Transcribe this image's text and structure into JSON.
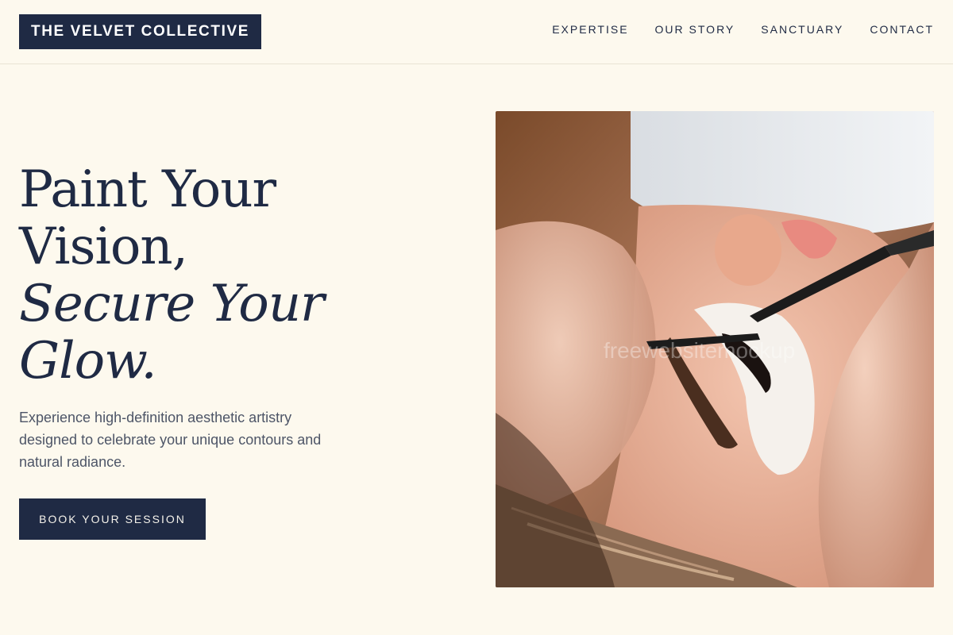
{
  "header": {
    "logo": "THE VELVET COLLECTIVE",
    "nav": [
      {
        "label": "EXPERTISE"
      },
      {
        "label": "OUR STORY"
      },
      {
        "label": "SANCTUARY"
      },
      {
        "label": "CONTACT"
      }
    ]
  },
  "hero": {
    "title_line1": "Paint Your",
    "title_line2": "Vision,",
    "title_line3": "Secure Your",
    "title_line4": "Glow.",
    "description": "Experience high-definition aesthetic artistry designed to celebrate your unique contours and natural radiance.",
    "cta_label": "BOOK YOUR SESSION"
  },
  "image": {
    "subject": "eyelash-extension-treatment-photo",
    "watermark": "freewebsitemockup"
  },
  "colors": {
    "background": "#fdf9ee",
    "primary": "#1f2a44",
    "body_text": "#4d5567"
  }
}
